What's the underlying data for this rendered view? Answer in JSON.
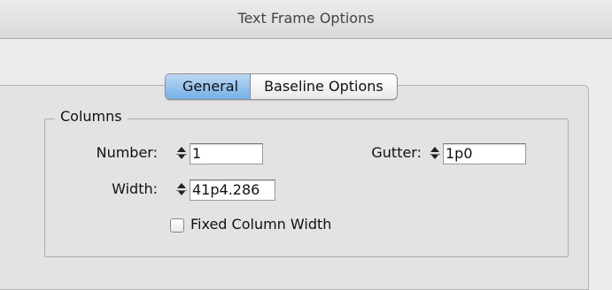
{
  "window": {
    "title": "Text Frame Options"
  },
  "tabs": [
    {
      "label": "General",
      "active": true
    },
    {
      "label": "Baseline Options",
      "active": false
    }
  ],
  "columns": {
    "legend": "Columns",
    "number_label": "Number:",
    "number_value": "1",
    "gutter_label": "Gutter:",
    "gutter_value": "1p0",
    "width_label": "Width:",
    "width_value": "41p4.286",
    "fixed_width_label": "Fixed Column Width",
    "fixed_width_checked": false
  },
  "colors": {
    "active_tab": "#74b0e8",
    "background": "#ececec"
  }
}
